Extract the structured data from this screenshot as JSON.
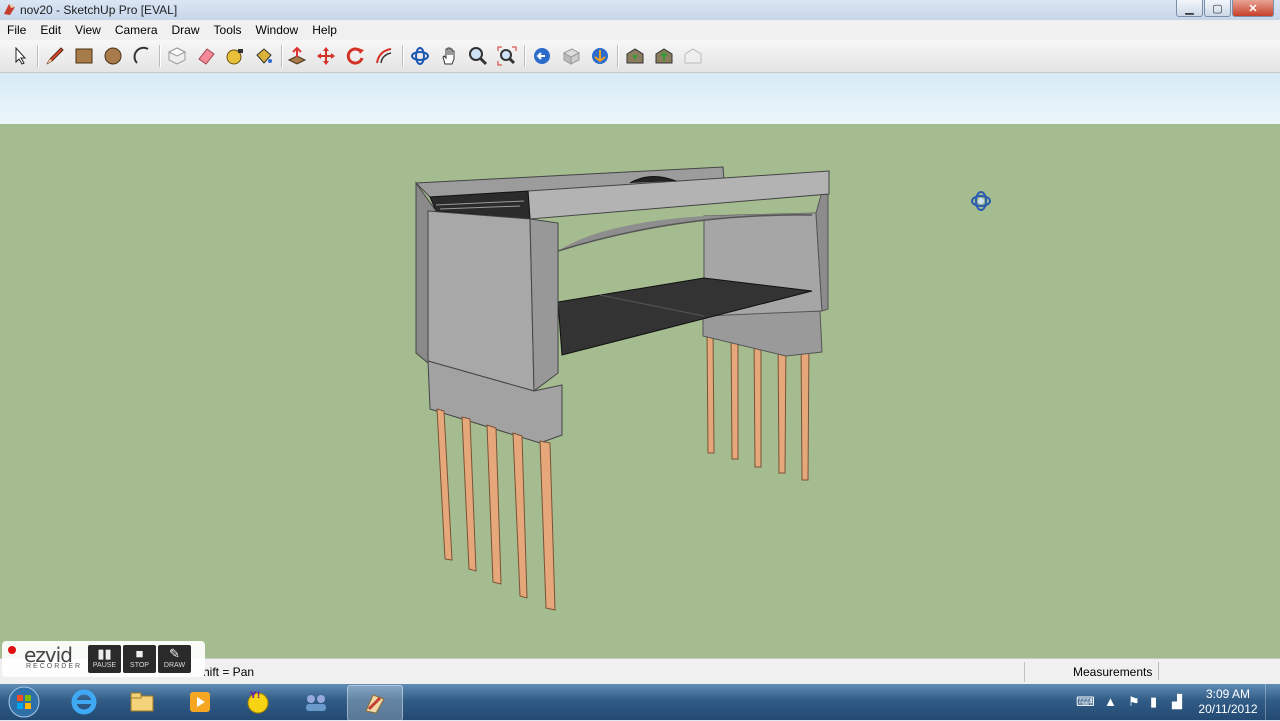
{
  "window": {
    "title": "nov20 - SketchUp Pro [EVAL]",
    "minimize_glyph": "▁",
    "maximize_glyph": "▢",
    "close_glyph": "✕"
  },
  "menu": [
    "File",
    "Edit",
    "View",
    "Camera",
    "Draw",
    "Tools",
    "Window",
    "Help"
  ],
  "toolbar": {
    "tools": [
      "select",
      "line",
      "rectangle",
      "circle",
      "arc",
      "make-component",
      "eraser",
      "tape-measure",
      "paint-bucket",
      "push-pull",
      "move",
      "rotate",
      "offset",
      "orbit",
      "pan",
      "zoom",
      "zoom-extents",
      "previous-view",
      "next-view",
      "standard-views",
      "3d-warehouse",
      "share-model",
      "get-models"
    ]
  },
  "status": {
    "hint": "hift = Pan",
    "measurements_label": "Measurements",
    "measurements_value": ""
  },
  "ezvid": {
    "logo": "ezvid",
    "sub": "RECORDER",
    "buttons": [
      "PAUSE",
      "STOP",
      "DRAW"
    ]
  },
  "taskbar": {
    "apps": [
      "internet-explorer",
      "file-explorer",
      "media-player",
      "yahoo-messenger",
      "network-app",
      "sketchup"
    ],
    "active_app": "sketchup",
    "time": "3:09 AM",
    "date": "20/11/2012"
  },
  "colors": {
    "ground": "#a5bc91",
    "sky": "#d6ebf6",
    "concrete": "#8c8c8c",
    "piles": "#e6a87a",
    "deck": "#333333"
  }
}
